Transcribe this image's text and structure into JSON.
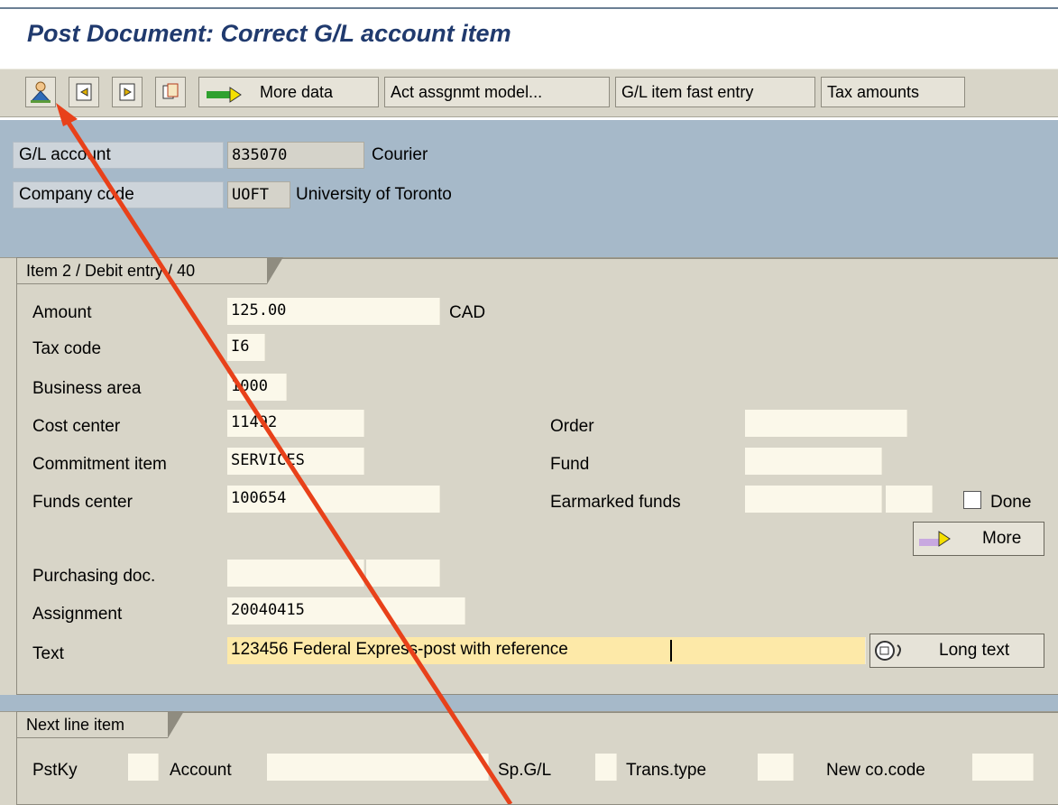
{
  "title": "Post Document: Correct G/L account item",
  "toolbar": {
    "icons": [
      "person-overview-icon",
      "previous-item-icon",
      "next-item-icon",
      "copy-icon"
    ],
    "more_data": "More data",
    "act_assignment_model": "Act assgnmt model...",
    "gl_fast_entry": "G/L item fast entry",
    "tax_amounts": "Tax amounts"
  },
  "header": {
    "gl_account_label": "G/L account",
    "gl_account_value": "835070",
    "gl_account_desc": "Courier",
    "company_code_label": "Company code",
    "company_code_value": "UOFT",
    "company_code_desc": "University of Toronto"
  },
  "item": {
    "tab_label": "Item 2 / Debit entry / 40",
    "amount_label": "Amount",
    "amount_value": "125.00",
    "currency": "CAD",
    "tax_code_label": "Tax code",
    "tax_code_value": "I6",
    "business_area_label": "Business area",
    "business_area_value": "1000",
    "cost_center_label": "Cost center",
    "cost_center_value": "11492",
    "order_label": "Order",
    "order_value": "",
    "commitment_item_label": "Commitment item",
    "commitment_item_value": "SERVICES",
    "fund_label": "Fund",
    "fund_value": "",
    "funds_center_label": "Funds center",
    "funds_center_value": "100654",
    "earmarked_label": "Earmarked funds",
    "earmarked_value": "",
    "done_label": "Done",
    "done_checked": false,
    "more_button": "More",
    "purchasing_doc_label": "Purchasing doc.",
    "purchasing_doc_value": "",
    "assignment_label": "Assignment",
    "assignment_value": "20040415",
    "text_label": "Text",
    "text_value": "123456 Federal Express-post with reference",
    "long_text_button": "Long text"
  },
  "next_line": {
    "tab_label": "Next line item",
    "pstky_label": "PstKy",
    "account_label": "Account",
    "spgl_label": "Sp.G/L",
    "trans_type_label": "Trans.type",
    "new_co_code_label": "New co.code"
  },
  "colors": {
    "title": "#203a6e",
    "header_bg": "#a6b9c9",
    "panel_bg": "#d8d5c8",
    "annotation_arrow": "#e8411a"
  }
}
